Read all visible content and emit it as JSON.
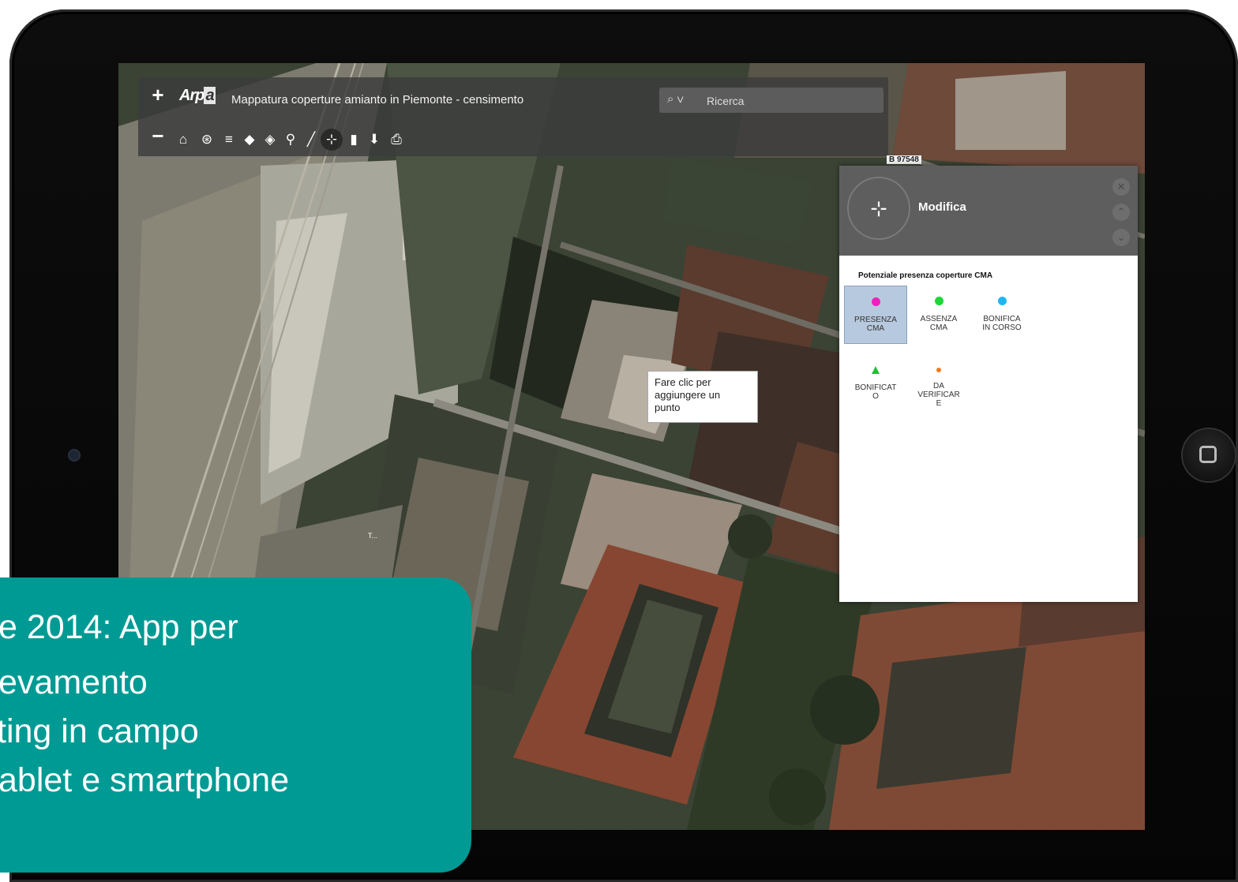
{
  "app": {
    "logo_text": "Arp",
    "logo_accent": "a",
    "title": "Mappatura coperture amianto in Piemonte - censimento"
  },
  "search": {
    "icon": "search-icon",
    "placeholder": "Ricerca"
  },
  "zoom": {
    "in_label": "+",
    "out_label": "−"
  },
  "toolbar": {
    "tools": [
      {
        "name": "home-icon",
        "glyph": "⌂"
      },
      {
        "name": "locate-icon",
        "glyph": "⊛"
      },
      {
        "name": "list-icon",
        "glyph": "≡"
      },
      {
        "name": "layers-icon",
        "glyph": "◆"
      },
      {
        "name": "basemap-icon",
        "glyph": "◈"
      },
      {
        "name": "legend-icon",
        "glyph": "⚲"
      },
      {
        "name": "draw-icon",
        "glyph": "╱"
      },
      {
        "name": "edit-icon",
        "glyph": "⊹",
        "active": true
      },
      {
        "name": "comment-icon",
        "glyph": "▮"
      },
      {
        "name": "download-icon",
        "glyph": "⬇"
      },
      {
        "name": "print-icon",
        "glyph": "⎙"
      }
    ]
  },
  "map": {
    "parcel_label": "B 97548",
    "street_label": "T..."
  },
  "tooltip": {
    "text_lines": [
      "Fare clic per",
      "aggiungere un",
      "punto"
    ]
  },
  "panel": {
    "title": "Modifica",
    "subtitle": "Potenziale presenza coperture CMA",
    "legend": [
      {
        "label_lines": [
          "PRESENZA",
          "CMA"
        ],
        "color": "#f01fbe",
        "shape": "circle",
        "selected": true
      },
      {
        "label_lines": [
          "ASSENZA",
          "CMA"
        ],
        "color": "#1ed53a",
        "shape": "circle",
        "selected": false
      },
      {
        "label_lines": [
          "BONIFICA",
          "IN CORSO"
        ],
        "color": "#20b7f0",
        "shape": "circle",
        "selected": false
      },
      {
        "label_lines": [
          "BONIFICAT",
          "O"
        ],
        "color": "#19c43b",
        "shape": "triangle",
        "selected": false
      },
      {
        "label_lines": [
          "DA",
          "VERIFICAR",
          "E"
        ],
        "color": "#f07a22",
        "shape": "dot",
        "selected": false
      }
    ]
  },
  "caption": {
    "lines": [
      "e 2014:  App per",
      "evamento",
      "ting in campo",
      "ablet e smartphone"
    ]
  },
  "colors": {
    "caption_bg": "#009a94",
    "toolbar_bg": "#3c3c3c",
    "panel_head": "#5e5e5e"
  }
}
